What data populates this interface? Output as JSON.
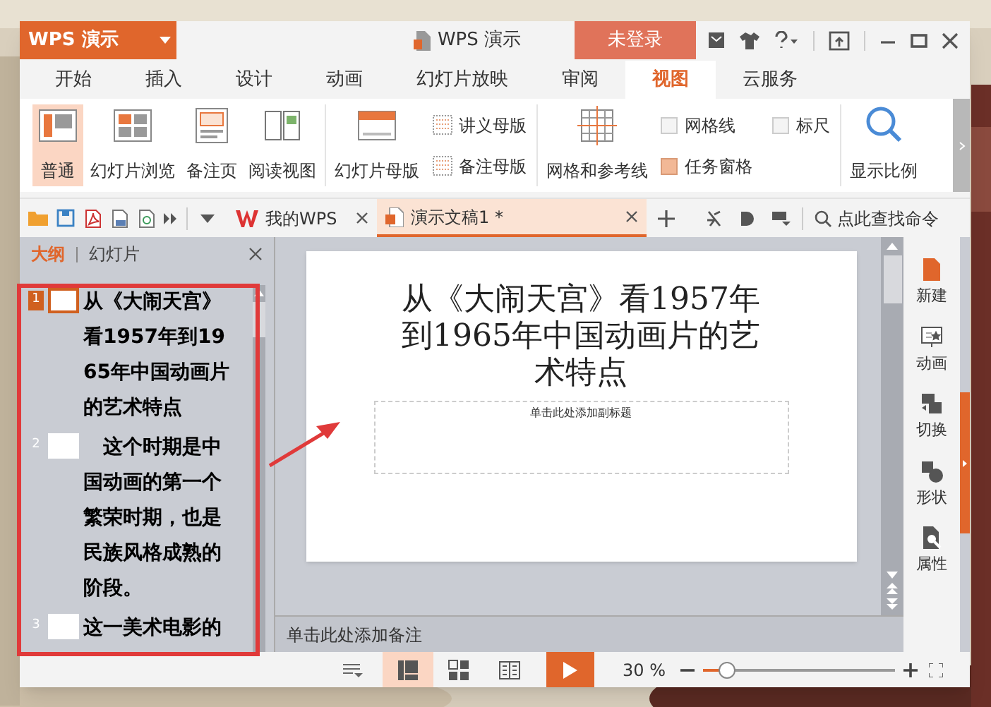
{
  "app": {
    "logo": "WPS 演示",
    "title": "WPS 演示",
    "login": "未登录"
  },
  "tabs": [
    {
      "label": "开始",
      "selected": false
    },
    {
      "label": "插入",
      "selected": false
    },
    {
      "label": "设计",
      "selected": false
    },
    {
      "label": "动画",
      "selected": false
    },
    {
      "label": "幻灯片放映",
      "selected": false
    },
    {
      "label": "审阅",
      "selected": false
    },
    {
      "label": "视图",
      "selected": true
    },
    {
      "label": "云服务",
      "selected": false
    }
  ],
  "ribbon_groups": [
    [
      {
        "kind": "large",
        "label": "普通",
        "selected": true
      },
      {
        "kind": "large",
        "label": "幻灯片浏览",
        "selected": false
      },
      {
        "kind": "large",
        "label": "备注页",
        "selected": false
      },
      {
        "kind": "large",
        "label": "阅读视图",
        "selected": false
      }
    ],
    [
      {
        "kind": "large",
        "label": "幻灯片母版",
        "selected": false
      },
      {
        "kind": "small",
        "label": "讲义母版"
      },
      {
        "kind": "small",
        "label": "备注母版"
      }
    ],
    [
      {
        "kind": "large",
        "label": "网格和参考线",
        "selected": false
      },
      {
        "kind": "check",
        "label": "网格线",
        "checked": false
      },
      {
        "kind": "check",
        "label": "任务窗格",
        "checked": true
      },
      {
        "kind": "check",
        "label": "标尺",
        "checked": false
      }
    ],
    [
      {
        "kind": "large",
        "label": "显示比例",
        "selected": false
      }
    ]
  ],
  "doc_tabs": [
    {
      "label": "我的WPS",
      "selected": false
    },
    {
      "label": "演示文稿1 *",
      "selected": true
    }
  ],
  "search": {
    "placeholder": "点此查找命令"
  },
  "panel": {
    "tabs": [
      {
        "label": "大纲",
        "selected": true
      },
      {
        "label": "幻灯片",
        "selected": false
      }
    ],
    "outline": [
      {
        "number": "1",
        "text": "从《大闹天宫》看1957年到1965年中国动画片的艺术特点",
        "selected": true
      },
      {
        "number": "2",
        "text": "　这个时期是中国动画的第一个繁荣时期，也是民族风格成熟的阶段。",
        "selected": false
      },
      {
        "number": "3",
        "text": "这一美术电影的",
        "selected": false
      }
    ]
  },
  "slide": {
    "title": "从《大闹天宫》看1957年到1965年中国动画片的艺术特点",
    "subtitle_placeholder": "单击此处添加副标题"
  },
  "notes": {
    "placeholder": "单击此处添加备注"
  },
  "task_pane": [
    {
      "label": "新建"
    },
    {
      "label": "动画"
    },
    {
      "label": "切换"
    },
    {
      "label": "形状"
    },
    {
      "label": "属性"
    }
  ],
  "status_bar": {
    "views": [
      {
        "kind": "normal",
        "selected": true
      },
      {
        "kind": "sorter",
        "selected": false
      },
      {
        "kind": "reading",
        "selected": false
      }
    ],
    "zoom": "30 %",
    "zoom_slider": {
      "level": 0.13
    }
  }
}
